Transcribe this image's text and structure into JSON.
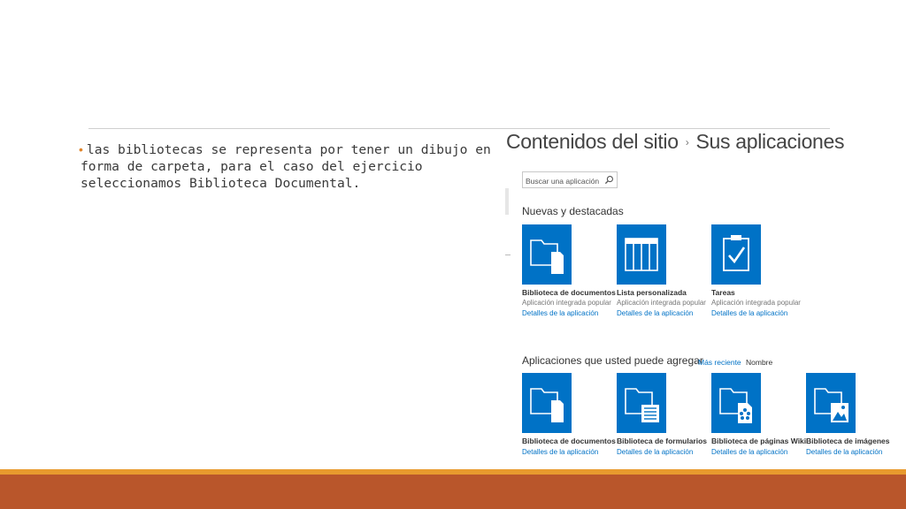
{
  "slide": {
    "bullet_text": "las bibliotecas se representa por tener un dibujo en forma de carpeta, para el caso del ejercicio seleccionamos Biblioteca Documental.",
    "bullet_color": "#e0852b",
    "footer_colors": [
      "#e89a2e",
      "#b9562b"
    ]
  },
  "screenshot": {
    "breadcrumb": {
      "parent": "Contenidos del sitio",
      "separator": "›",
      "current": "Sus aplicaciones"
    },
    "search": {
      "placeholder": "Buscar una aplicación",
      "icon": "search-icon"
    },
    "featured": {
      "title": "Nuevas y destacadas",
      "apps": [
        {
          "title": "Biblioteca de documentos",
          "subtitle": "Aplicación integrada popular",
          "link": "Detalles de la aplicación",
          "icon": "document-library-icon"
        },
        {
          "title": "Lista personalizada",
          "subtitle": "Aplicación integrada popular",
          "link": "Detalles de la aplicación",
          "icon": "custom-list-icon"
        },
        {
          "title": "Tareas",
          "subtitle": "Aplicación integrada popular",
          "link": "Detalles de la aplicación",
          "icon": "tasks-icon"
        }
      ]
    },
    "addable": {
      "title": "Aplicaciones que usted puede agregar",
      "sort_recent": "Más reciente",
      "sort_name": "Nombre",
      "apps": [
        {
          "title": "Biblioteca de documentos",
          "link": "Detalles de la aplicación",
          "icon": "document-library-icon"
        },
        {
          "title": "Biblioteca de formularios",
          "link": "Detalles de la aplicación",
          "icon": "form-library-icon"
        },
        {
          "title": "Biblioteca de páginas Wiki",
          "link": "Detalles de la aplicación",
          "icon": "wiki-page-library-icon"
        },
        {
          "title": "Biblioteca de imágenes",
          "link": "Detalles de la aplicación",
          "icon": "picture-library-icon"
        }
      ]
    },
    "accent_color": "#0072c6"
  }
}
